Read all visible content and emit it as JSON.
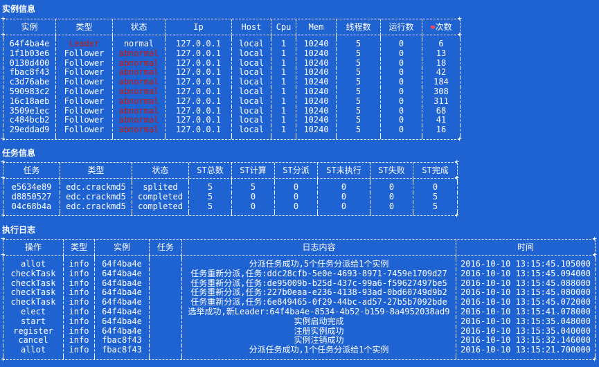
{
  "instances": {
    "title": "实例信息",
    "headers": [
      "实例",
      "类型",
      "状态",
      "Ip",
      "Host",
      "Cpu",
      "Mem",
      "线程数",
      "运行数",
      "次数"
    ],
    "count_icon": "heart-icon",
    "rows": [
      [
        "64f4ba4e",
        "Leader",
        "normal",
        "127.0.0.1",
        "local",
        "1",
        "10240",
        "5",
        "0",
        "6"
      ],
      [
        "1f1b03e6",
        "Follower",
        "abnormal",
        "127.0.0.1",
        "local",
        "1",
        "10240",
        "5",
        "0",
        "13"
      ],
      [
        "0130d400",
        "Follower",
        "abnormal",
        "127.0.0.1",
        "local",
        "1",
        "10240",
        "5",
        "0",
        "18"
      ],
      [
        "fbac8f43",
        "Follower",
        "abnormal",
        "127.0.0.1",
        "local",
        "1",
        "10240",
        "5",
        "0",
        "42"
      ],
      [
        "c3d76abe",
        "Follower",
        "abnormal",
        "127.0.0.1",
        "local",
        "1",
        "10240",
        "5",
        "0",
        "184"
      ],
      [
        "590983c2",
        "Follower",
        "abnormal",
        "127.0.0.1",
        "local",
        "1",
        "10240",
        "5",
        "0",
        "308"
      ],
      [
        "16c18aeb",
        "Follower",
        "abnormal",
        "127.0.0.1",
        "local",
        "1",
        "10240",
        "5",
        "0",
        "311"
      ],
      [
        "3509e1ec",
        "Follower",
        "abnormal",
        "127.0.0.1",
        "local",
        "1",
        "10240",
        "5",
        "0",
        "68"
      ],
      [
        "c484bcb2",
        "Follower",
        "abnormal",
        "127.0.0.1",
        "local",
        "1",
        "10240",
        "5",
        "0",
        "41"
      ],
      [
        "29eddad9",
        "Follower",
        "abnormal",
        "127.0.0.1",
        "local",
        "1",
        "10240",
        "5",
        "0",
        "16"
      ]
    ]
  },
  "tasks": {
    "title": "任务信息",
    "headers": [
      "任务",
      "类型",
      "状态",
      "ST总数",
      "ST计算",
      "ST分派",
      "ST未执行",
      "ST失败",
      "ST完成"
    ],
    "rows": [
      [
        "e5634e89",
        "edc.crackmd5",
        "splited",
        "5",
        "5",
        "0",
        "0",
        "0",
        "0"
      ],
      [
        "d8850527",
        "edc.crackmd5",
        "completed",
        "5",
        "0",
        "0",
        "0",
        "0",
        "5"
      ],
      [
        "04c68b4a",
        "edc.crackmd5",
        "completed",
        "5",
        "0",
        "0",
        "0",
        "0",
        "5"
      ]
    ]
  },
  "logs": {
    "title": "执行日志",
    "headers": [
      "操作",
      "类型",
      "实例",
      "任务",
      "日志内容",
      "时间"
    ],
    "rows": [
      [
        "allot",
        "info",
        "64f4ba4e",
        "",
        "分派任务成功,5个任务分派给1个实例",
        "2016-10-10 13:15:45.105000"
      ],
      [
        "checkTask",
        "info",
        "64f4ba4e",
        "",
        "任务重新分派,任务:ddc28cfb-5e0e-4693-8971-7459e1709d27",
        "2016-10-10 13:15:45.094000"
      ],
      [
        "checkTask",
        "info",
        "64f4ba4e",
        "",
        "任务重新分派,任务:de95009b-b25d-437c-99a6-f59627497be5",
        "2016-10-10 13:15:45.088000"
      ],
      [
        "checkTask",
        "info",
        "64f4ba4e",
        "",
        "任务重新分派,任务:227b0eaa-e236-4138-93ad-0bd60749d9b2",
        "2016-10-10 13:15:45.080000"
      ],
      [
        "checkTask",
        "info",
        "64f4ba4e",
        "",
        "任务重新分派,任务:6e849465-0f29-44bc-ad57-27b5b7092bde",
        "2016-10-10 13:15:45.072000"
      ],
      [
        "elect",
        "info",
        "64f4ba4e",
        "",
        "选举成功,新Leader:64f4ba4e-8534-4b52-b159-8a4952038ad9",
        "2016-10-10 13:15:41.078000"
      ],
      [
        "start",
        "info",
        "64f4ba4e",
        "",
        "实例启动完成",
        "2016-10-10 13:15:35.048000"
      ],
      [
        "register",
        "info",
        "64f4ba4e",
        "",
        "注册实例成功",
        "2016-10-10 13:15:35.040000"
      ],
      [
        "cancel",
        "info",
        "fbac8f43",
        "",
        "实例注销成功",
        "2016-10-10 13:15:32.146000"
      ],
      [
        "allot",
        "info",
        "fbac8f43",
        "",
        "分派任务成功,1个任务分派给1个实例",
        "2016-10-10 13:15:21.700000"
      ]
    ]
  },
  "colors": {
    "background": "#1f62d2",
    "text": "#ffffff",
    "leader": "#c6190c",
    "abnormal": "#c6190c"
  }
}
